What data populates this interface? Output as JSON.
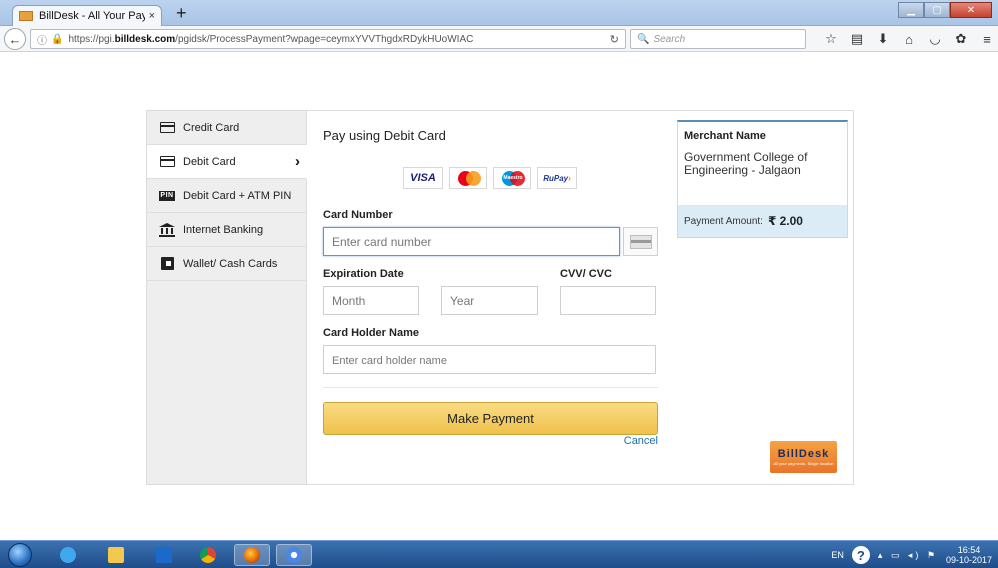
{
  "browser": {
    "tab_title": "BillDesk - All Your Payments.",
    "tab_close": "×",
    "new_tab": "+",
    "url_prefix": "https://pgi.",
    "url_domain": "billdesk.com",
    "url_path": "/pgidsk/ProcessPayment?wpage=ceymxYVVThgdxRDykHUoWIAC",
    "search_placeholder": "Search"
  },
  "sidebar": {
    "items": [
      {
        "label": "Credit Card",
        "icon": "credit-card-icon"
      },
      {
        "label": "Debit Card",
        "icon": "debit-card-icon",
        "active": true
      },
      {
        "label": "Debit Card + ATM PIN",
        "icon": "pin-icon",
        "icon_text": "PIN"
      },
      {
        "label": "Internet Banking",
        "icon": "bank-icon"
      },
      {
        "label": "Wallet/ Cash Cards",
        "icon": "wallet-icon"
      }
    ]
  },
  "main": {
    "title": "Pay using Debit Card",
    "card_logos": {
      "visa": "VISA",
      "maestro": "Maestro",
      "rupay_a": "RuPay",
      "rupay_b": "›"
    },
    "card_number_label": "Card Number",
    "card_number_placeholder": "Enter card number",
    "expiration_label": "Expiration Date",
    "month_placeholder": "Month",
    "year_placeholder": "Year",
    "cvv_label": "CVV/ CVC",
    "holder_label": "Card Holder Name",
    "holder_placeholder": "Enter card holder name",
    "pay_button": "Make Payment",
    "cancel": "Cancel"
  },
  "merchant": {
    "title": "Merchant Name",
    "name": "Government College of Engineering - Jalgaon",
    "amount_label": "Payment Amount:",
    "amount_value": "₹  2.00"
  },
  "billdesk": {
    "name_a": "Bill",
    "name_b": "Desk",
    "tagline": "All your payments. Single location"
  },
  "taskbar": {
    "lang": "EN",
    "time": "16:54",
    "date": "09-10-2017"
  },
  "colors": {
    "accent": "#f0c14b",
    "link": "#1a6fb3",
    "amount_bg": "#dcecf6"
  }
}
